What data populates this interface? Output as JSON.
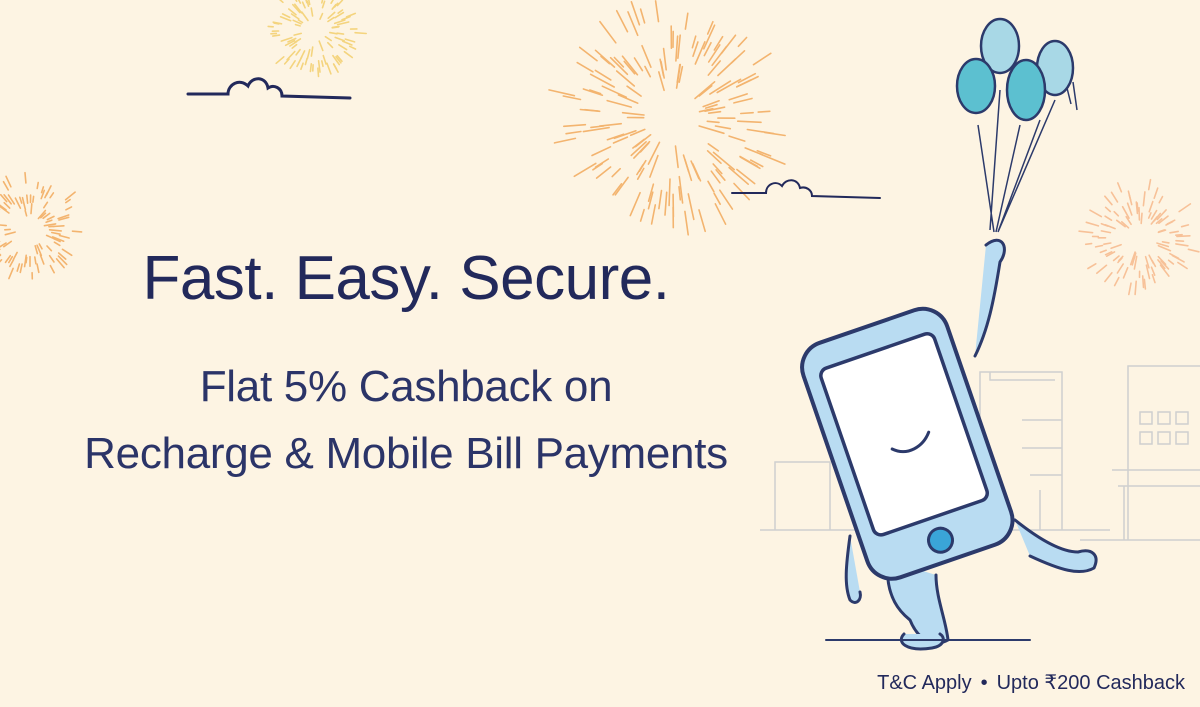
{
  "banner": {
    "headline": "Fast. Easy. Secure.",
    "subline_1": "Flat 5% Cashback on",
    "subline_2": "Recharge & Mobile Bill Payments",
    "terms": "T&C Apply",
    "separator": "•",
    "cashback_cap": "Upto ₹200 Cashback"
  },
  "colors": {
    "background": "#fdf4e3",
    "text_navy": "#22295b",
    "phone_body": "#b9dcf2",
    "phone_outline": "#2c3a6b",
    "balloon_teal": "#5cc0d0",
    "balloon_light": "#a8d8e6",
    "firework_yellow": "#f3cf6d",
    "firework_orange": "#f2a95b",
    "firework_peach": "#f7b98c"
  },
  "icons": [
    "firework",
    "cloud",
    "balloon",
    "phone-mascot",
    "building"
  ]
}
